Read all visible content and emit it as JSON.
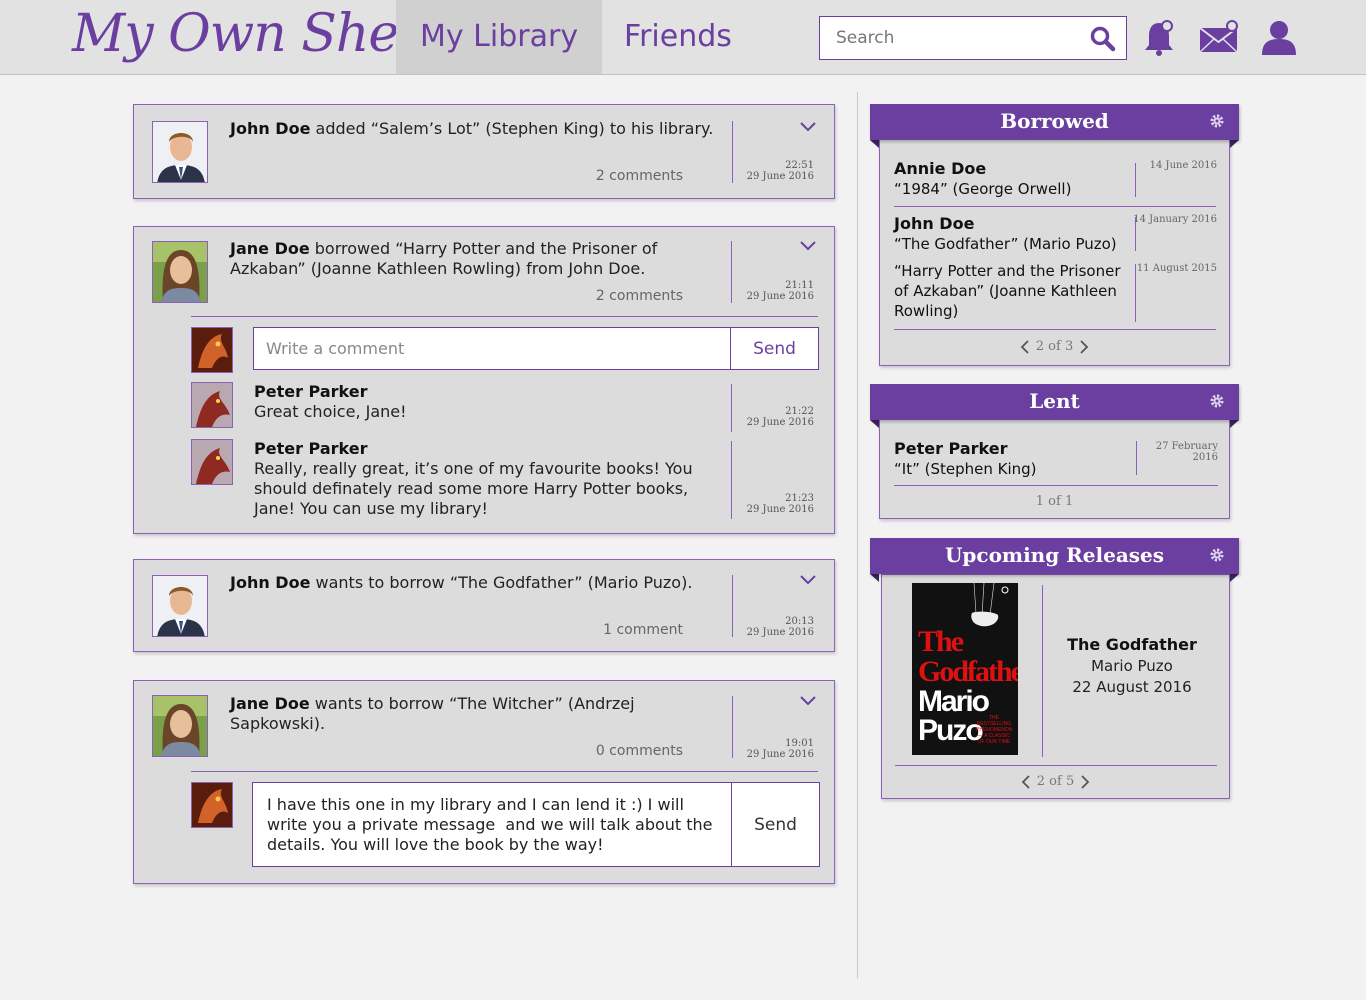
{
  "header": {
    "logo": "My Own Shelf",
    "nav": [
      {
        "label": "My Library",
        "active": true
      },
      {
        "label": "Friends",
        "active": false
      }
    ],
    "search_placeholder": "Search",
    "brand_color": "#6b3fa0",
    "icons": [
      "search-icon",
      "bell-icon",
      "mail-icon",
      "user-icon"
    ]
  },
  "feed": [
    {
      "user": "John Doe",
      "text_before": " added “",
      "book": "Salem’s Lot",
      "text_mid": "” (",
      "author": "Stephen King",
      "text_after": ") to his library.",
      "comments": "2 comments",
      "time": "22:51",
      "date": "29 June 2016"
    },
    {
      "user": "Jane Doe",
      "text_before": " borrowed “",
      "book": "Harry Potter and the Prisoner of Azkaban",
      "text_mid": "” (",
      "author": "Joanne Kathleen Rowling",
      "text_after": ") from John Doe.",
      "comments": "2 comments",
      "time": "21:11",
      "date": "29 June 2016",
      "comment_placeholder": "Write a comment",
      "send_label": "Send",
      "replies": [
        {
          "name": "Peter Parker",
          "text": "Great choice, Jane!",
          "time": "21:22",
          "date": "29 June 2016"
        },
        {
          "name": "Peter Parker",
          "text": "Really, really great, it’s one of my favourite books! You should definately read some more Harry Potter books, Jane! You can use my library!",
          "time": "21:23",
          "date": "29 June 2016"
        }
      ]
    },
    {
      "user": "John Doe",
      "text_before": " wants to borrow “",
      "book": "The Godfather",
      "text_mid": "” (",
      "author": "Mario Puzo",
      "text_after": ").",
      "comments": "1 comment",
      "time": "20:13",
      "date": "29 June 2016"
    },
    {
      "user": "Jane Doe",
      "text_before": " wants to borrow “",
      "book": "The Witcher",
      "text_mid": "” (",
      "author": "Andrzej Sapkowski",
      "text_after": ").",
      "comments": "0 comments",
      "time": "19:01",
      "date": "29 June 2016",
      "draft_comment": "I have this one in my library and I can lend it :) I will write you a private message  and we will talk about the details. You will love the book by the way!",
      "send_label": "Send"
    }
  ],
  "borrowed": {
    "title": "Borrowed",
    "items": [
      {
        "name": "Annie Doe",
        "book": "“1984” (George Orwell)",
        "date": "14 June 2016"
      },
      {
        "name": "John Doe",
        "book": "“The Godfather” (Mario Puzo)",
        "date": "14 January 2016"
      },
      {
        "name": "",
        "book": "“Harry Potter and the Prisoner of Azkaban” (Joanne Kathleen Rowling)",
        "date": "11 August 2015"
      }
    ],
    "pager": "2 of 3"
  },
  "lent": {
    "title": "Lent",
    "items": [
      {
        "name": "Peter Parker",
        "book": "“It” (Stephen King)",
        "date": "27 February 2016"
      }
    ],
    "pager": "1 of 1"
  },
  "upcoming": {
    "title": "Upcoming Releases",
    "cover": {
      "title": "The Godfather",
      "author": "Mario Puzo",
      "blurb": "THE BESTSELLING PHENOMENON— A CLASSIC OF OUR TIME"
    },
    "book_title": "The Godfather",
    "author": "Mario Puzo",
    "release_date": "22 August 2016",
    "pager": "2 of 5"
  }
}
